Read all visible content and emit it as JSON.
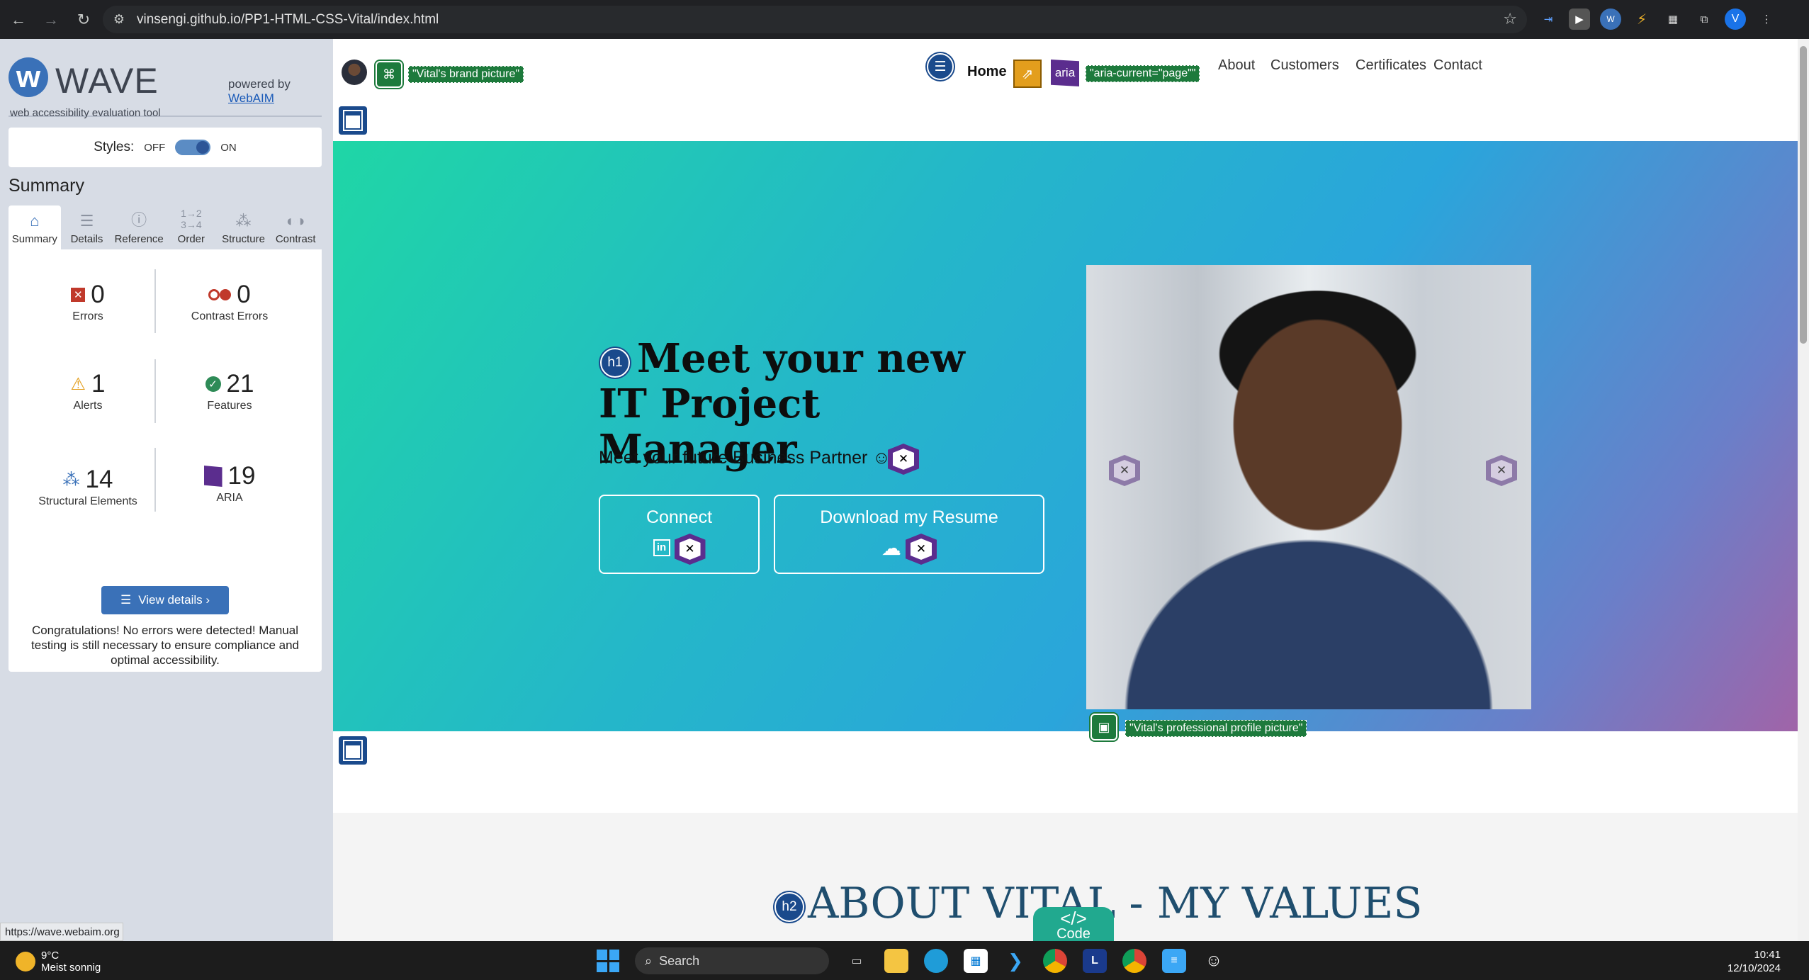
{
  "browser": {
    "url": "vinsengi.github.io/PP1-HTML-CSS-Vital/index.html",
    "profile_initial": "V"
  },
  "wave": {
    "logo_text": "WAVE",
    "tagline": "web accessibility evaluation tool",
    "powered_by": "powered by",
    "webaim_link": "WebAIM",
    "styles_label": "Styles:",
    "styles_off": "OFF",
    "styles_on": "ON",
    "summary_title": "Summary",
    "tabs": [
      {
        "label": "Summary",
        "icon": "home-icon"
      },
      {
        "label": "Details",
        "icon": "list-icon"
      },
      {
        "label": "Reference",
        "icon": "info-icon"
      },
      {
        "label": "Order",
        "icon": "order-icon"
      },
      {
        "label": "Structure",
        "icon": "structure-icon"
      },
      {
        "label": "Contrast",
        "icon": "contrast-icon"
      }
    ],
    "stats": {
      "errors": {
        "value": "0",
        "label": "Errors"
      },
      "contrast_errors": {
        "value": "0",
        "label": "Contrast Errors"
      },
      "alerts": {
        "value": "1",
        "label": "Alerts"
      },
      "features": {
        "value": "21",
        "label": "Features"
      },
      "structural": {
        "value": "14",
        "label": "Structural Elements"
      },
      "aria": {
        "value": "19",
        "label": "ARIA"
      }
    },
    "view_details": "View details ›",
    "congrats": "Congratulations! No errors were detected! Manual testing is still necessary to ensure compliance and optimal accessibility.",
    "status_url": "https://wave.webaim.org",
    "colors": {
      "accent": "#3a71b8",
      "error": "#c0392b",
      "alert": "#e39e1d",
      "feature": "#2e8b57",
      "aria": "#5b2d8e"
    }
  },
  "page": {
    "brand_alt": "\"Vital's brand picture\"",
    "nav": {
      "home": "Home",
      "aria_icon": "aria",
      "aria_current": "\"aria-current=\"page\"\"",
      "about": "About",
      "customers": "Customers",
      "certificates": "Certificates",
      "contact": "Contact"
    },
    "h1_badge": "h1",
    "hero_title": "Meet your new IT Project Manager",
    "hero_sub": "Meet your future Business Partner ☺",
    "connect": "Connect",
    "download": "Download my Resume",
    "profile_alt": "\"Vital's professional profile picture\"",
    "h2_badge": "h2",
    "section_title": "ABOUT VITAL - MY VALUES",
    "code_tab": "Code",
    "code_symbol": "</>",
    "hero_gradient": [
      "#1fd6a6",
      "#2aa5db",
      "#a064a8"
    ]
  },
  "taskbar": {
    "temperature": "9°C",
    "weather": "Meist sonnig",
    "search": "Search",
    "time": "10:41",
    "date": "12/10/2024"
  }
}
